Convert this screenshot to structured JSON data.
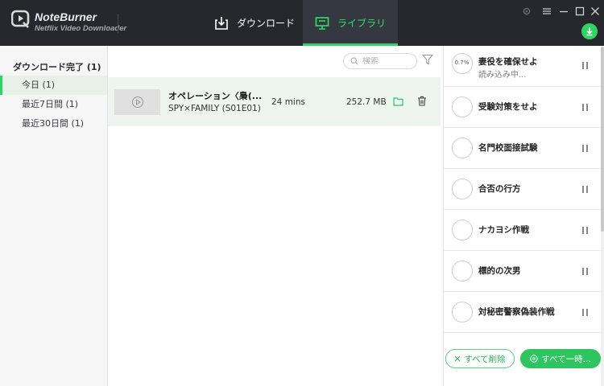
{
  "app": {
    "name": "NoteBurner",
    "subtitle": "Netflix Video Downloader"
  },
  "nav": {
    "download_label": "ダウンロード",
    "library_label": "ライブラリ",
    "active_tab": "library",
    "accent_color": "#2fd561"
  },
  "sidebar": {
    "heading": "ダウンロード完了 (1)",
    "items": [
      {
        "label": "今日 (1)",
        "active": true
      },
      {
        "label": "最近7日間 (1)",
        "active": false
      },
      {
        "label": "最近30日間 (1)",
        "active": false
      }
    ]
  },
  "library": {
    "search_placeholder": "検索",
    "items": [
      {
        "title": "オペレーション〈梟(...",
        "subtitle": "SPY×FAMILY (S01E01)",
        "duration": "24 mins",
        "size": "252.7 MB"
      }
    ]
  },
  "queue": {
    "items": [
      {
        "title": "妻役を確保せよ",
        "status": "読み込み中...",
        "progress": "0.7%"
      },
      {
        "title": "受験対策をせよ"
      },
      {
        "title": "名門校面接試験"
      },
      {
        "title": "合否の行方"
      },
      {
        "title": "ナカヨシ作戦"
      },
      {
        "title": "標的の次男"
      },
      {
        "title": "対秘密警察偽装作戦"
      }
    ],
    "delete_all_label": "すべて削除",
    "pause_all_label": "すべて一時..."
  }
}
